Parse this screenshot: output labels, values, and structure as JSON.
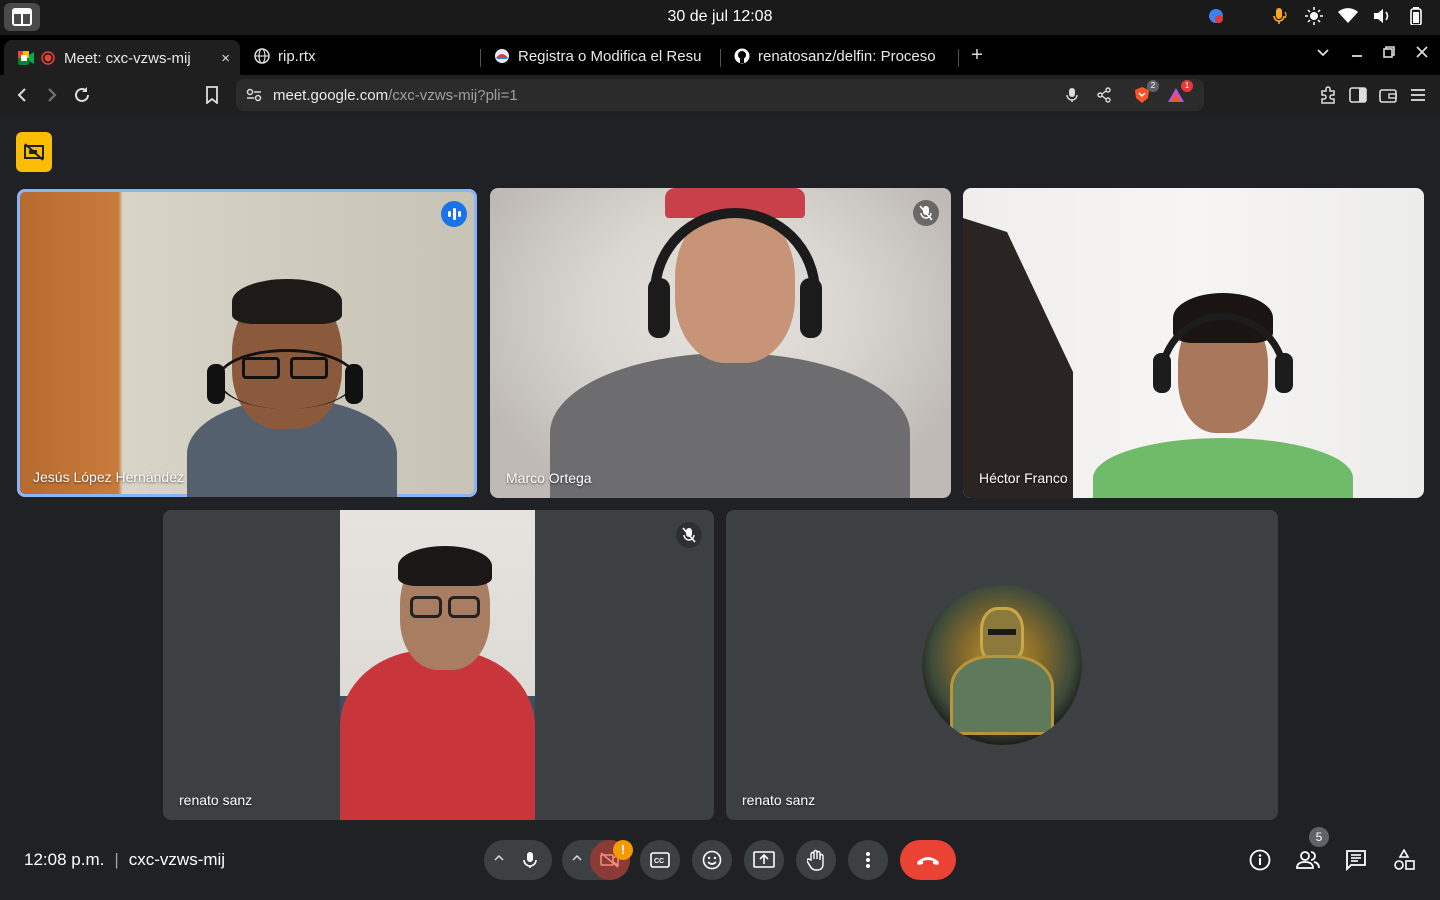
{
  "os": {
    "clock": "30 de jul  12:08"
  },
  "tabs": [
    {
      "title": "Meet: cxc-vzws-mij",
      "close": "×",
      "recording": true
    },
    {
      "title": "rip.rtx"
    },
    {
      "title": "Registra o Modifica el Resu"
    },
    {
      "title": "renatosanz/delfin: Proceso"
    }
  ],
  "toolbar": {
    "url_host": "meet.google.com",
    "url_path": "/cxc-vzws-mij?pli=1",
    "brave_badge": "2",
    "rewards_badge": "1"
  },
  "participants": [
    {
      "name": "Jesús López Hernández",
      "speaking": true
    },
    {
      "name": "Marco Ortega",
      "muted": true
    },
    {
      "name": "Héctor Franco"
    },
    {
      "name": "renato sanz",
      "muted": true
    },
    {
      "name": "renato sanz"
    }
  ],
  "meeting": {
    "time": "12:08 p.m.",
    "separator": "|",
    "code": "cxc-vzws-mij",
    "people_count": "5",
    "camera_warning": "!"
  },
  "colors": {
    "end_call": "#ea4335",
    "speaking": "#1a73e8",
    "recording_indicator": "#fbbc04"
  }
}
